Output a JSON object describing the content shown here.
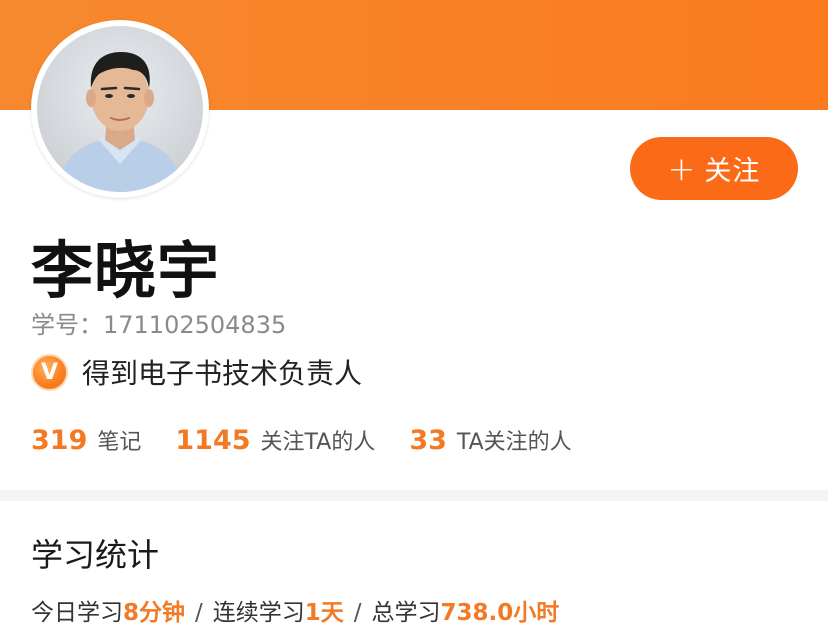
{
  "profile": {
    "name": "李晓宇",
    "student_id_label": "学号：",
    "student_id": "171102504835",
    "verified_badge_letter": "V",
    "verified_title": "得到电子书技术负责人",
    "follow_button": {
      "icon": "+",
      "label": "关注"
    }
  },
  "stats": [
    {
      "value": "319",
      "label": "笔记"
    },
    {
      "value": "1145",
      "label": "关注TA的人"
    },
    {
      "value": "33",
      "label": "TA关注的人"
    }
  ],
  "study_stats": {
    "title": "学习统计",
    "today_label": "今日学习",
    "today_value": "8分钟",
    "streak_label": "连续学习",
    "streak_value": "1天",
    "total_label": "总学习",
    "total_value": "738.0小时",
    "separator": "/"
  },
  "colors": {
    "banner": "#f98127",
    "accent": "#f27a24",
    "button": "#fb6a16"
  },
  "icons": {
    "avatar": "user-photo",
    "verified": "verified-v-badge",
    "follow": "plus-icon"
  }
}
